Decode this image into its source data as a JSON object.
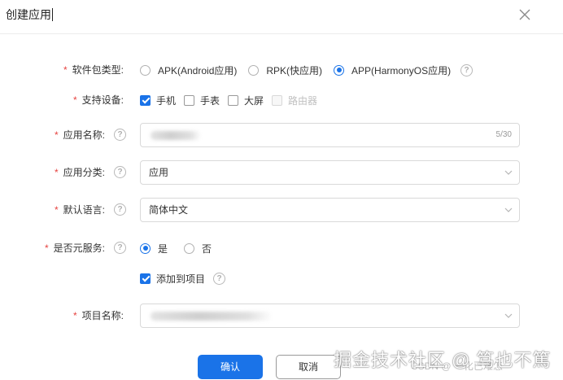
{
  "dialog": {
    "title": "创建应用",
    "close_icon": "close-icon"
  },
  "form": {
    "package_type": {
      "label": "软件包类型:",
      "options": [
        "APK(Android应用)",
        "RPK(快应用)",
        "APP(HarmonyOS应用)"
      ],
      "selected": "APP(HarmonyOS应用)"
    },
    "devices": {
      "label": "支持设备:",
      "options": [
        {
          "label": "手机",
          "checked": true,
          "disabled": false
        },
        {
          "label": "手表",
          "checked": false,
          "disabled": false
        },
        {
          "label": "大屏",
          "checked": false,
          "disabled": false
        },
        {
          "label": "路由器",
          "checked": false,
          "disabled": true
        }
      ]
    },
    "app_name": {
      "label": "应用名称:",
      "counter": "5/30"
    },
    "app_category": {
      "label": "应用分类:",
      "value": "应用"
    },
    "default_language": {
      "label": "默认语言:",
      "value": "简体中文"
    },
    "meta_service": {
      "label": "是否元服务:",
      "options": [
        "是",
        "否"
      ],
      "selected": "是"
    },
    "add_to_project": {
      "label": "添加到项目",
      "checked": true
    },
    "project_name": {
      "label": "项目名称:"
    }
  },
  "buttons": {
    "confirm": "确认",
    "cancel": "取消"
  },
  "watermark": {
    "text": "掘金技术社区 @ 笃也不篤",
    "faint": "CSDN @ 一化已难怎"
  },
  "colors": {
    "accent": "#1a73e8",
    "required": "#e64340"
  }
}
